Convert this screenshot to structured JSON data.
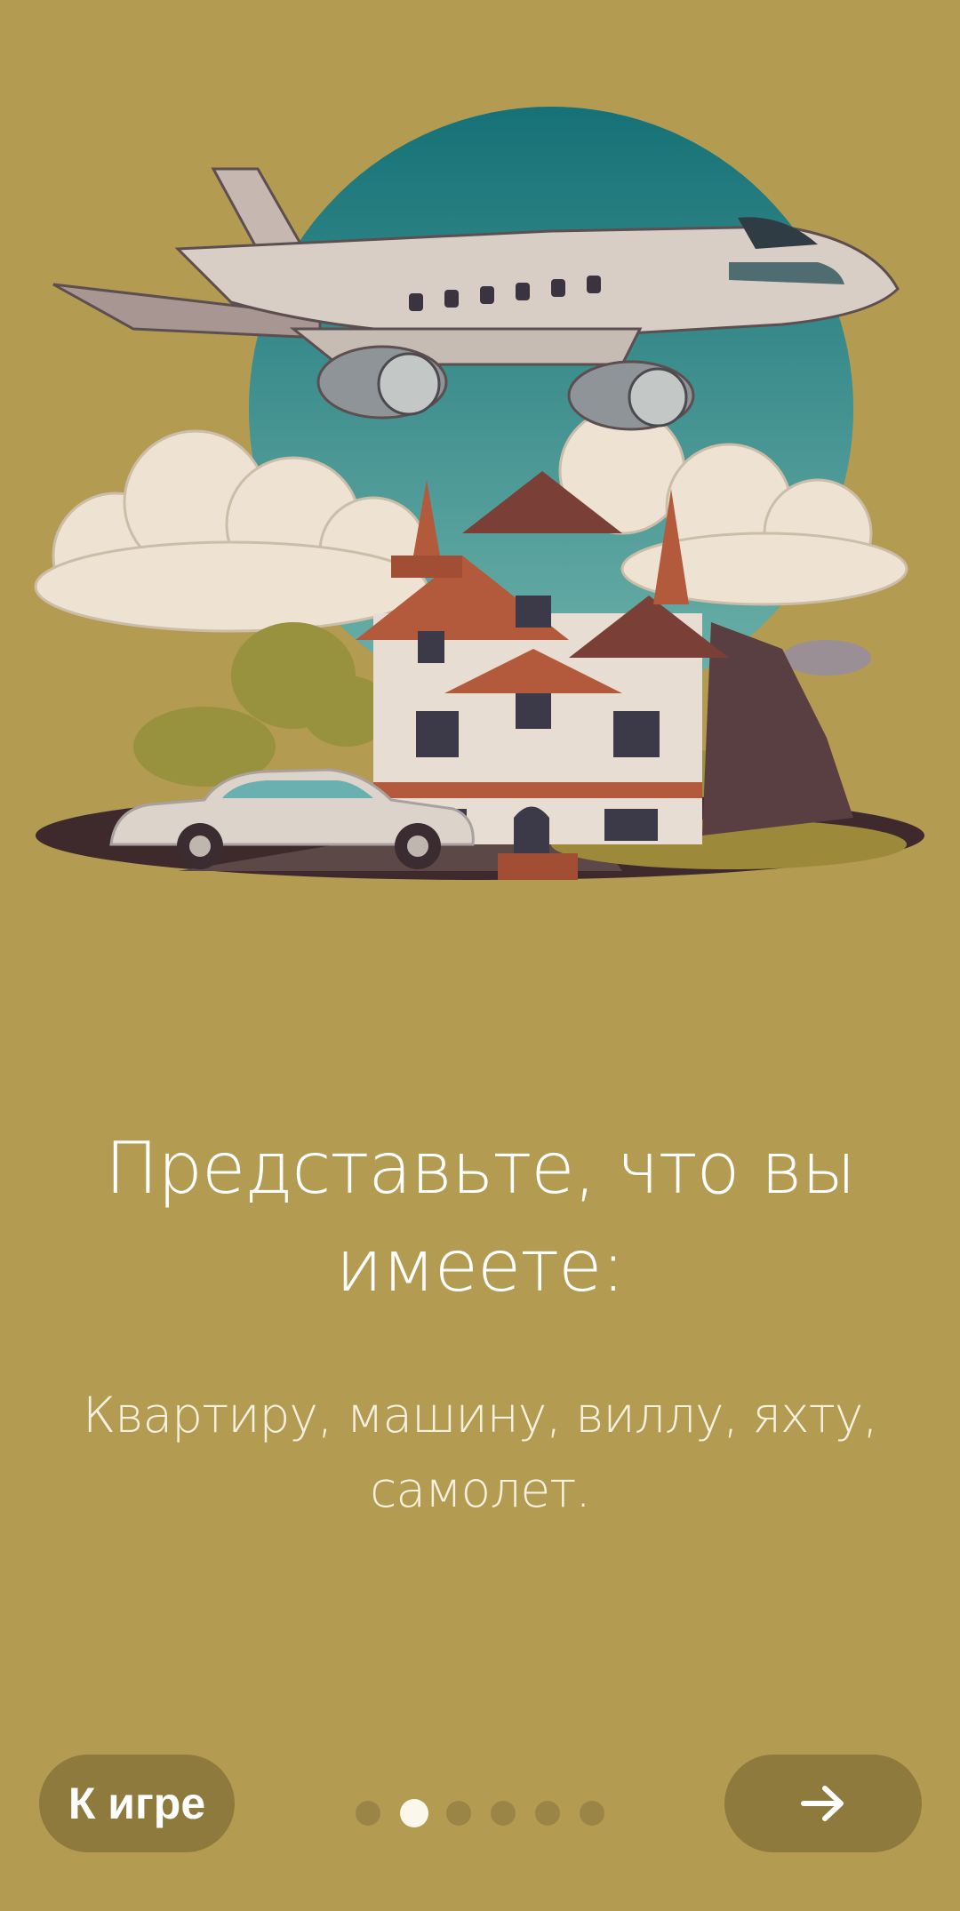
{
  "onboarding": {
    "title": "Представьте, что вы имеете:",
    "subtitle": "Квартиру, машину, виллу, яхту, самолет.",
    "illustration": "plane-house-car-illustration"
  },
  "footer": {
    "skip_label": "К игре",
    "next_icon": "arrow-right-icon",
    "pagination": {
      "total": 6,
      "current": 2
    }
  },
  "colors": {
    "background": "#b39c52",
    "button": "#8f7a3e",
    "dot_active": "#fbf7ea",
    "dot_inactive": "#9a8546"
  }
}
